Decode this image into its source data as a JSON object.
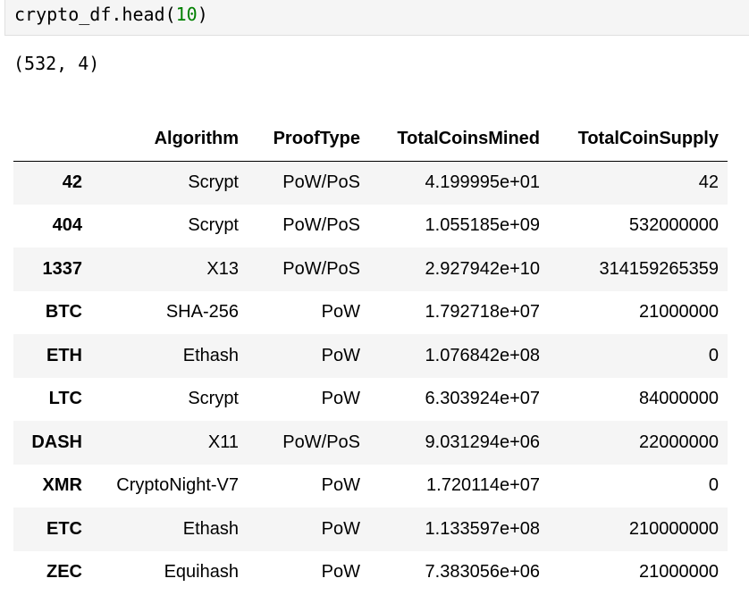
{
  "cell": {
    "code_prefix": "crypto_df.head(",
    "code_arg": "10",
    "code_suffix": ")"
  },
  "output": {
    "shape_text": "(532, 4)"
  },
  "table": {
    "columns": [
      "",
      "Algorithm",
      "ProofType",
      "TotalCoinsMined",
      "TotalCoinSupply"
    ],
    "rows": [
      {
        "index": "42",
        "cells": [
          "Scrypt",
          "PoW/PoS",
          "4.199995e+01",
          "42"
        ]
      },
      {
        "index": "404",
        "cells": [
          "Scrypt",
          "PoW/PoS",
          "1.055185e+09",
          "532000000"
        ]
      },
      {
        "index": "1337",
        "cells": [
          "X13",
          "PoW/PoS",
          "2.927942e+10",
          "314159265359"
        ]
      },
      {
        "index": "BTC",
        "cells": [
          "SHA-256",
          "PoW",
          "1.792718e+07",
          "21000000"
        ]
      },
      {
        "index": "ETH",
        "cells": [
          "Ethash",
          "PoW",
          "1.076842e+08",
          "0"
        ]
      },
      {
        "index": "LTC",
        "cells": [
          "Scrypt",
          "PoW",
          "6.303924e+07",
          "84000000"
        ]
      },
      {
        "index": "DASH",
        "cells": [
          "X11",
          "PoW/PoS",
          "9.031294e+06",
          "22000000"
        ]
      },
      {
        "index": "XMR",
        "cells": [
          "CryptoNight-V7",
          "PoW",
          "1.720114e+07",
          "0"
        ]
      },
      {
        "index": "ETC",
        "cells": [
          "Ethash",
          "PoW",
          "1.133597e+08",
          "210000000"
        ]
      },
      {
        "index": "ZEC",
        "cells": [
          "Equihash",
          "PoW",
          "7.383056e+06",
          "21000000"
        ]
      }
    ]
  }
}
